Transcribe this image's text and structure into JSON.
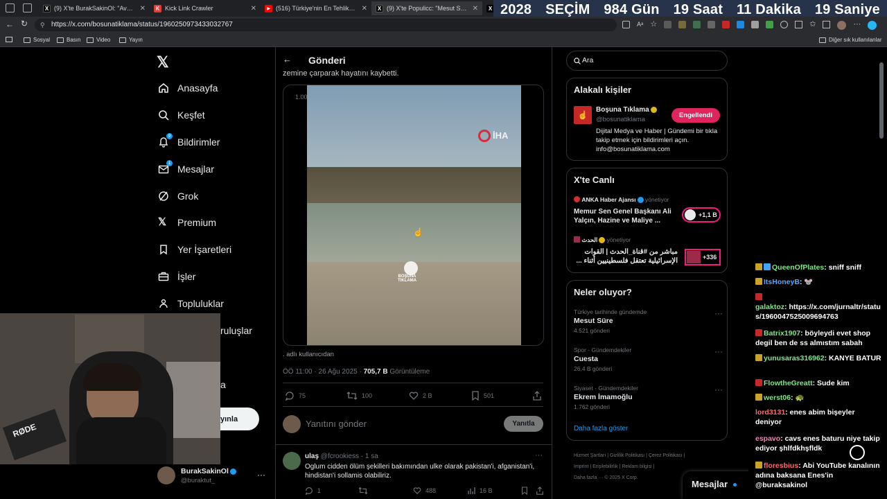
{
  "browser": {
    "tabs": [
      {
        "title": "(9) X'te BurakSakinOl: \"Avukatınız",
        "icon": "x-logo-icon",
        "color": "#000000"
      },
      {
        "title": "Kick Link Crawler",
        "icon": "kick-icon",
        "color": "#e53935"
      },
      {
        "title": "(516) Türkiye'nin En Tehlikeli Mah",
        "icon": "youtube-icon",
        "color": "#ff0000"
      },
      {
        "title": "(9) X'te Populicc: \"Mesut Süre hak",
        "icon": "x-logo-icon",
        "color": "#000000"
      }
    ],
    "url": "https://x.com/bosunatiklama/status/1960250973433032767",
    "bookmarks": [
      "Sosyal",
      "Basın",
      "Video",
      "Yayın"
    ],
    "other_bookmarks": "Diğer sık kullanılanlar"
  },
  "countdown": {
    "year": "2028",
    "label": "SEÇİM",
    "days": "984",
    "days_unit": "Gün",
    "hours": "19",
    "hours_unit": "Saat",
    "minutes": "11",
    "minutes_unit": "Dakika",
    "seconds": "19",
    "seconds_unit": "Saniye"
  },
  "sidebar": {
    "items": [
      {
        "label": "Anasayfa"
      },
      {
        "label": "Keşfet"
      },
      {
        "label": "Bildirimler",
        "badge": "9"
      },
      {
        "label": "Mesajlar",
        "badge": "1"
      },
      {
        "label": "Grok"
      },
      {
        "label": "Premium"
      },
      {
        "label": "Yer İşaretleri"
      },
      {
        "label": "İşler"
      },
      {
        "label": "Topluluklar"
      },
      {
        "label": "ruluşlar"
      },
      {
        "label": "a"
      }
    ],
    "post_button": "yınla",
    "account_name": "BurakSakinOl",
    "account_handle": "@buraktut_"
  },
  "feed": {
    "header_title": "Gönderi",
    "top_text": "zemine çarparak hayatını kaybetti.",
    "video_time": "1.00",
    "video_watermark": "İHA",
    "video_logo_line1": "BOŞUNA",
    "video_logo_line2": "TIKLAMA",
    "attribution": ". adlı kullanıcıdan",
    "timestamp": "ÖÖ 11:00 · 26 Ağu 2025 · ",
    "views_count": "705,7 B",
    "views_label": "Görüntüleme",
    "replies": "75",
    "reposts": "100",
    "likes": "2 B",
    "bookmarks": "501",
    "reply_placeholder": "Yanıtını gönder",
    "reply_button": "Yanıtla",
    "reply": {
      "name": "ulaş",
      "handle": "@fcrookiess · 1 sa",
      "text": "Oglum cidden ölüm şekilleri bakımından ulke olarak pakistan'i, afganistan'i, hindistan'i sollamis olabiliriz.",
      "replies": "1",
      "likes": "488",
      "views": "16 B"
    }
  },
  "right": {
    "search_placeholder": "Ara",
    "related_title": "Alakalı kişiler",
    "related": {
      "name": "Boşuna Tıklama",
      "handle": "@bosunatiklama",
      "bio": "Dijital Medya ve Haber | Gündemi bir tıkla takip etmek için bildirimleri açın. info@bosunatiklama.com",
      "button": "Engellendi"
    },
    "live_title": "X'te Canlı",
    "live": [
      {
        "host": "ANKA Haber Ajansı",
        "status": "yönetiyor",
        "title": "Memur Sen Genel Başkanı Ali Yalçın, Hazine ve Maliye ...",
        "count": "+1,1 B"
      },
      {
        "host": "الحدث",
        "status": "yönetiyor",
        "title": "مباشر من #قناة_الحدث | القوات الإسرائيلية تعتقل فلسطينيين أثناء ...",
        "count": "+336"
      }
    ],
    "trends_title": "Neler oluyor?",
    "trends": [
      {
        "category": "Türkiye tarihinde gündemde",
        "name": "Mesut Süre",
        "count": "4.521 gönderi"
      },
      {
        "category": "Spor · Gündemdekiler",
        "name": "Cuesta",
        "count": "26,4 B gönderi"
      },
      {
        "category": "Siyaset · Gündemdekiler",
        "name": "Ekrem İmamoğlu",
        "count": "1.762 gönderi"
      }
    ],
    "show_more": "Daha fazla göster",
    "footer_line1": "Hizmet Şartları  |  Gizlilik Politikası  |  Çerez Politikası  |",
    "footer_line2": "Imprint  |  Erişilebilirlik  |  Reklam bilgisi  |",
    "footer_line3": "Daha fazla ···  © 2025 X Corp.",
    "messages_label": "Mesajlar"
  },
  "chat": [
    {
      "user": "QueenOfPlates",
      "color": "#7ee787",
      "text": "sniff sniff"
    },
    {
      "user": "ItsHoneyB",
      "color": "#58a6ff",
      "text": "🐭"
    },
    {
      "user": "galaktoz",
      "color": "#7ee787",
      "text": "https://x.com/jurnaltr/status/1960047525009694763"
    },
    {
      "user": "Batrix1907",
      "color": "#7ee787",
      "text": "böyleydi evet shop degil ben de ss almıstım sabah"
    },
    {
      "user": "yunusaras316962",
      "color": "#7ee787",
      "text": "KANYE BATUR"
    },
    {
      "user": "FlowtheGreatt",
      "color": "#7ee787",
      "text": "Sude kim"
    },
    {
      "user": "werst06",
      "color": "#7ee787",
      "text": "🐢"
    },
    {
      "user": "lord3131",
      "color": "#ff6b6b",
      "text": "enes abim bişeyler deniyor"
    },
    {
      "user": "espavo",
      "color": "#ff7eb6",
      "text": "cavs enes baturu niye takip ediyor şhlfdkhşfldk"
    },
    {
      "user": "floresbius",
      "color": "#ff6b6b",
      "text": "Abi YouTube kanalının adına baksana Enes'in @buraksakinol"
    }
  ]
}
